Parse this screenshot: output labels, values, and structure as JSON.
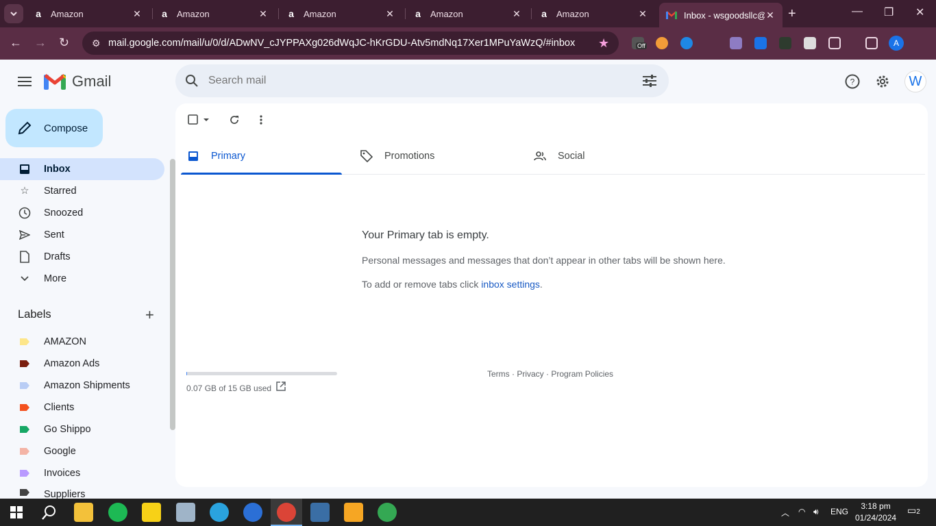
{
  "browser": {
    "tabs": [
      {
        "title": "Amazon",
        "favicon": "amazon-icon"
      },
      {
        "title": "Amazon",
        "favicon": "amazon-icon"
      },
      {
        "title": "Amazon",
        "favicon": "amazon-icon"
      },
      {
        "title": "Amazon",
        "favicon": "amazon-icon"
      },
      {
        "title": "Amazon",
        "favicon": "amazon-icon"
      },
      {
        "title": "Inbox - wsgoodsllc@",
        "favicon": "gmail-icon"
      }
    ],
    "url": "mail.google.com/mail/u/0/d/ADwNV_cJYPPAXg026dWqJC-hKrGDU-Atv5mdNq17Xer1MPuYaWzQ/#inbox",
    "ext_off_badge": "Off",
    "profile_initial": "A"
  },
  "gmail": {
    "logo_text": "Gmail",
    "search_placeholder": "Search mail",
    "avatar_initial": "W",
    "compose_label": "Compose",
    "nav": [
      {
        "label": "Inbox",
        "icon": "inbox-icon",
        "active": true
      },
      {
        "label": "Starred",
        "icon": "star-icon"
      },
      {
        "label": "Snoozed",
        "icon": "clock-icon"
      },
      {
        "label": "Sent",
        "icon": "send-icon"
      },
      {
        "label": "Drafts",
        "icon": "draft-icon"
      },
      {
        "label": "More",
        "icon": "chevron-down-icon"
      }
    ],
    "labels_header": "Labels",
    "labels": [
      {
        "name": "AMAZON",
        "color": "#fde68a"
      },
      {
        "name": "Amazon Ads",
        "color": "#7a1d0e"
      },
      {
        "name": "Amazon Shipments",
        "color": "#b9cdf5"
      },
      {
        "name": "Clients",
        "color": "#f4511e"
      },
      {
        "name": "Go Shippo",
        "color": "#16a765"
      },
      {
        "name": "Google",
        "color": "#f4b4a6"
      },
      {
        "name": "Invoices",
        "color": "#b99aff"
      },
      {
        "name": "Suppliers",
        "color": "#434343"
      }
    ],
    "tabs": [
      {
        "label": "Primary",
        "icon": "inbox-icon",
        "active": true
      },
      {
        "label": "Promotions",
        "icon": "tag-icon"
      },
      {
        "label": "Social",
        "icon": "people-icon"
      }
    ],
    "empty": {
      "title": "Your Primary tab is empty.",
      "desc": "Personal messages and messages that don’t appear in other tabs will be shown here.",
      "settings_prefix": "To add or remove tabs click ",
      "settings_link": "inbox settings",
      "settings_suffix": "."
    },
    "storage": {
      "text": "0.07 GB of 15 GB used",
      "used_fraction": 0.005
    },
    "footer": {
      "terms": "Terms",
      "privacy": "Privacy",
      "policies": "Program Policies",
      "sep": " · "
    }
  },
  "taskbar": {
    "lang": "ENG",
    "time": "3:18 pm",
    "date": "01/24/2024",
    "notification_count": "2"
  },
  "colors": {
    "accent": "#0b57d0",
    "compose_bg": "#c2e7ff",
    "active_nav": "#d3e3fd"
  }
}
